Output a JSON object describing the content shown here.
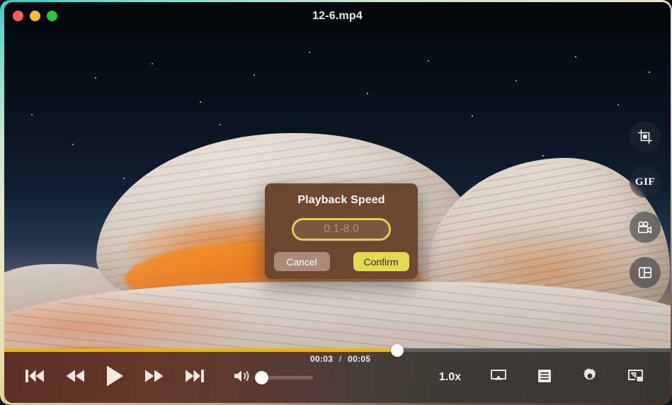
{
  "window": {
    "title": "12-6.mp4",
    "traffic_lights": [
      {
        "name": "close",
        "color": "#ff5f57"
      },
      {
        "name": "minimize",
        "color": "#febc2e"
      },
      {
        "name": "maximize",
        "color": "#28c840"
      }
    ],
    "rim_accent": "#3fc8c4"
  },
  "tool_rail": [
    {
      "name": "crop-icon",
      "label": "",
      "type": "icon"
    },
    {
      "name": "gif-icon",
      "label": "GIF",
      "type": "text"
    },
    {
      "name": "record-video-icon",
      "label": "",
      "type": "icon"
    },
    {
      "name": "split-view-icon",
      "label": "",
      "type": "icon"
    }
  ],
  "dialog": {
    "title": "Playback Speed",
    "input_value": "",
    "input_placeholder": "0.1-8.0",
    "cancel_label": "Cancel",
    "confirm_label": "Confirm",
    "border_color": "#ddd05a",
    "confirm_color": "#e2da52",
    "cancel_color": "#ab8a77",
    "background_color": "#6e4730"
  },
  "player": {
    "current_time": "00:03",
    "total_time": "00:05",
    "time_separator": "/",
    "progress_percent": 59,
    "volume_percent": 6,
    "speed_label": "1.0x",
    "progress_color": "#e5b12a",
    "transport": [
      {
        "name": "previous-track-button"
      },
      {
        "name": "rewind-button"
      },
      {
        "name": "play-button"
      },
      {
        "name": "fast-forward-button"
      },
      {
        "name": "next-track-button"
      }
    ],
    "right_controls": [
      {
        "name": "airplay-button"
      },
      {
        "name": "playlist-button"
      },
      {
        "name": "settings-button"
      },
      {
        "name": "picture-in-picture-button"
      }
    ]
  }
}
